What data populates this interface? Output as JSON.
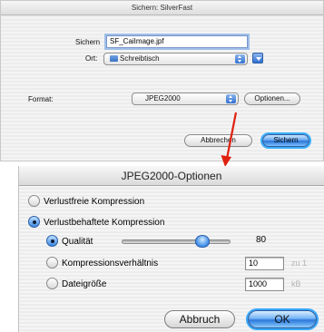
{
  "save_dialog": {
    "title": "Sichern: SilverFast",
    "save_as_label": "Sichern",
    "filename_value": "SF_CaiImage.jpf",
    "location_label": "Ort:",
    "location_value": "Schreibtisch",
    "format_label": "Format:",
    "format_value": "JPEG2000",
    "options_button": "Optionen...",
    "cancel_button": "Abbrechen",
    "save_button": "Sichern"
  },
  "options_dialog": {
    "title": "JPEG2000-Optionen",
    "lossless_label": "Verlustfreie Kompression",
    "lossless_selected": false,
    "lossy_label": "Verlustbehaftete Kompression",
    "lossy_selected": true,
    "quality_label": "Qualität",
    "quality_selected": true,
    "quality_value": "80",
    "ratio_label": "Kompressionsverhältnis",
    "ratio_selected": false,
    "ratio_value": "10",
    "ratio_unit": "zu 1",
    "filesize_label": "Dateigröße",
    "filesize_selected": false,
    "filesize_value": "1000",
    "filesize_unit": "kB",
    "cancel_button": "Abbruch",
    "ok_button": "OK"
  },
  "colors": {
    "aqua_blue": "#2f6fd1",
    "arrow_red": "#e02010"
  }
}
